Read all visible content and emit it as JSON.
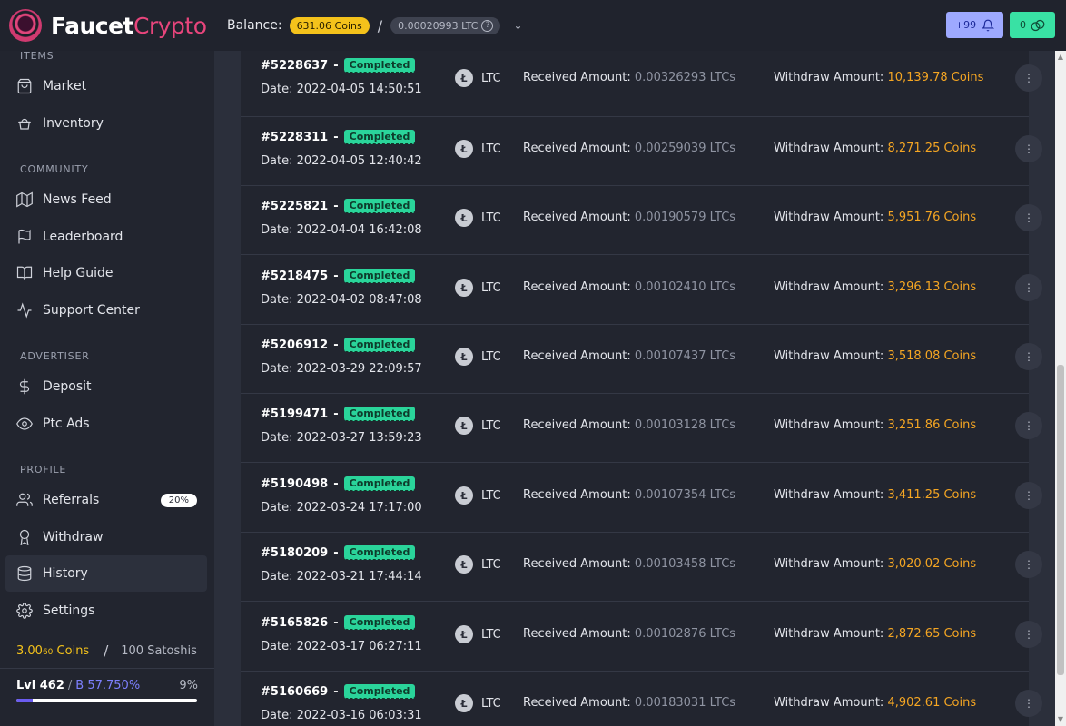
{
  "brand": {
    "part1": "Faucet",
    "part2": "Crypto"
  },
  "header": {
    "balance_label": "Balance:",
    "coins": "631.06 Coins",
    "separator": "/",
    "ltc": "0.00020993 LTC",
    "help_glyph": "?",
    "caret_glyph": "⌄",
    "notifications": "+99",
    "gifts": "0"
  },
  "sidebar": {
    "sections": [
      {
        "title": "ITEMS"
      },
      {
        "title": "COMMUNITY"
      },
      {
        "title": "ADVERTISER"
      },
      {
        "title": "PROFILE"
      }
    ],
    "items": [
      {
        "label": "Market",
        "icon": "bag-icon"
      },
      {
        "label": "Inventory",
        "icon": "basket-icon"
      },
      {
        "label": "News Feed",
        "icon": "map-icon"
      },
      {
        "label": "Leaderboard",
        "icon": "flag-icon"
      },
      {
        "label": "Help Guide",
        "icon": "book-icon"
      },
      {
        "label": "Support Center",
        "icon": "activity-icon"
      },
      {
        "label": "Deposit",
        "icon": "dollar-icon"
      },
      {
        "label": "Ptc Ads",
        "icon": "eye-icon"
      },
      {
        "label": "Referrals",
        "icon": "users-icon",
        "badge": "20%"
      },
      {
        "label": "Withdraw",
        "icon": "award-icon"
      },
      {
        "label": "History",
        "icon": "database-icon",
        "active": true
      },
      {
        "label": "Settings",
        "icon": "gear-icon"
      }
    ],
    "rates": {
      "coins_main": "3.00",
      "coins_sup": "60",
      "coins_unit": "Coins",
      "separator": "/",
      "satoshi": "100 Satoshis"
    },
    "level": {
      "label": "Lvl 462",
      "divider": "/",
      "bonus": "B 57.750%",
      "progress_text": "9%",
      "progress": 0.09
    }
  },
  "history": {
    "status_label": "Completed",
    "dash": "-",
    "date_prefix": "Date: ",
    "coin_symbol": "Ł",
    "currency": "LTC",
    "received_label": "Received Amount: ",
    "withdraw_label": "Withdraw Amount: ",
    "more_glyph": "⋮",
    "rows": [
      {
        "id": "#5228637",
        "date": "2022-04-05 14:50:51",
        "received": "0.00326293 LTCs",
        "withdraw": "10,139.78 Coins"
      },
      {
        "id": "#5228311",
        "date": "2022-04-05 12:40:42",
        "received": "0.00259039 LTCs",
        "withdraw": "8,271.25 Coins"
      },
      {
        "id": "#5225821",
        "date": "2022-04-04 16:42:08",
        "received": "0.00190579 LTCs",
        "withdraw": "5,951.76 Coins"
      },
      {
        "id": "#5218475",
        "date": "2022-04-02 08:47:08",
        "received": "0.00102410 LTCs",
        "withdraw": "3,296.13 Coins"
      },
      {
        "id": "#5206912",
        "date": "2022-03-29 22:09:57",
        "received": "0.00107437 LTCs",
        "withdraw": "3,518.08 Coins"
      },
      {
        "id": "#5199471",
        "date": "2022-03-27 13:59:23",
        "received": "0.00103128 LTCs",
        "withdraw": "3,251.86 Coins"
      },
      {
        "id": "#5190498",
        "date": "2022-03-24 17:17:00",
        "received": "0.00107354 LTCs",
        "withdraw": "3,411.25 Coins"
      },
      {
        "id": "#5180209",
        "date": "2022-03-21 17:44:14",
        "received": "0.00103458 LTCs",
        "withdraw": "3,020.02 Coins"
      },
      {
        "id": "#5165826",
        "date": "2022-03-17 06:27:11",
        "received": "0.00102876 LTCs",
        "withdraw": "2,872.65 Coins"
      },
      {
        "id": "#5160669",
        "date": "2022-03-16 06:03:31",
        "received": "0.00183031 LTCs",
        "withdraw": "4,902.61 Coins"
      }
    ]
  },
  "scrollbar": {
    "up_glyph": "▲",
    "down_glyph": "▼"
  }
}
